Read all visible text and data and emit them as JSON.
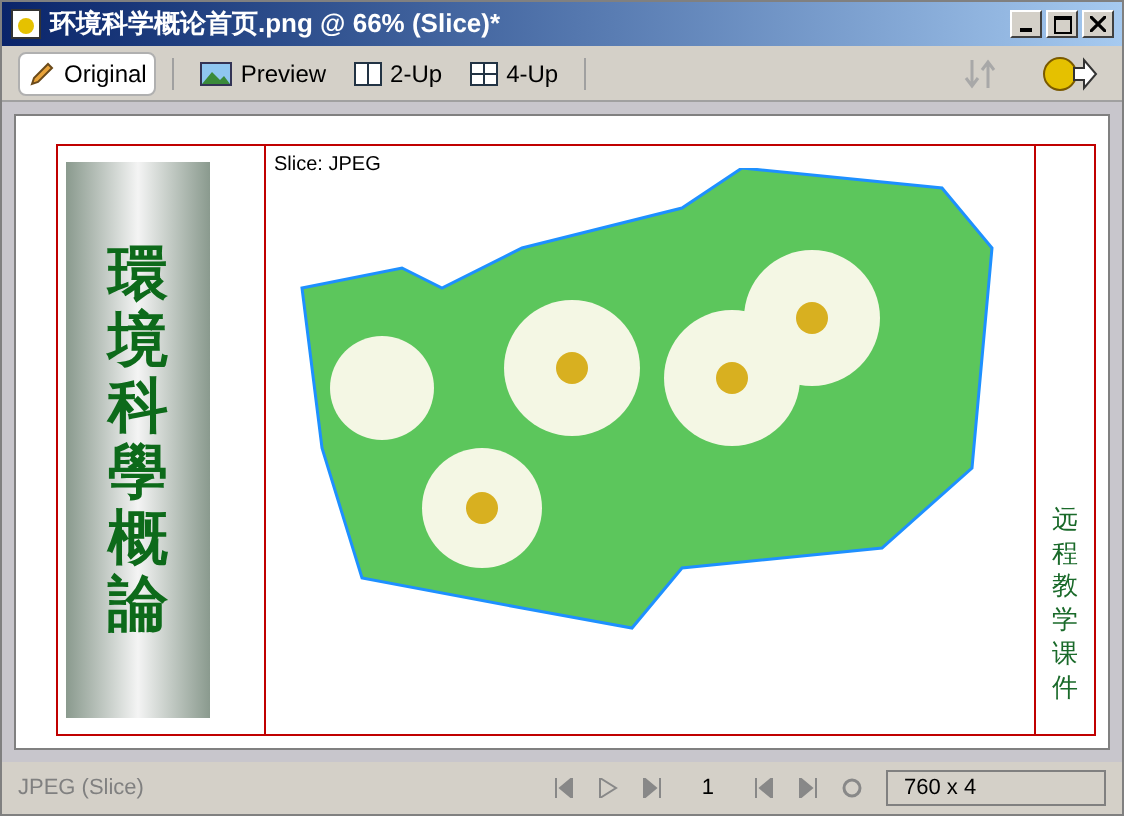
{
  "window": {
    "title": "环境科学概论首页.png @ 66% (Slice)*"
  },
  "tabs": [
    {
      "label": "Original",
      "kind": "pencil",
      "selected": true
    },
    {
      "label": "Preview",
      "kind": "picture",
      "selected": false
    },
    {
      "label": "2-Up",
      "kind": "two",
      "selected": false
    },
    {
      "label": "4-Up",
      "kind": "four",
      "selected": false
    }
  ],
  "document": {
    "banner_title": "環境科學概論",
    "slice_label": "Slice: JPEG",
    "side_text": "远程教学课件"
  },
  "status_bar": {
    "format": "JPEG (Slice)",
    "frame": "1",
    "size": "760 x 4"
  }
}
